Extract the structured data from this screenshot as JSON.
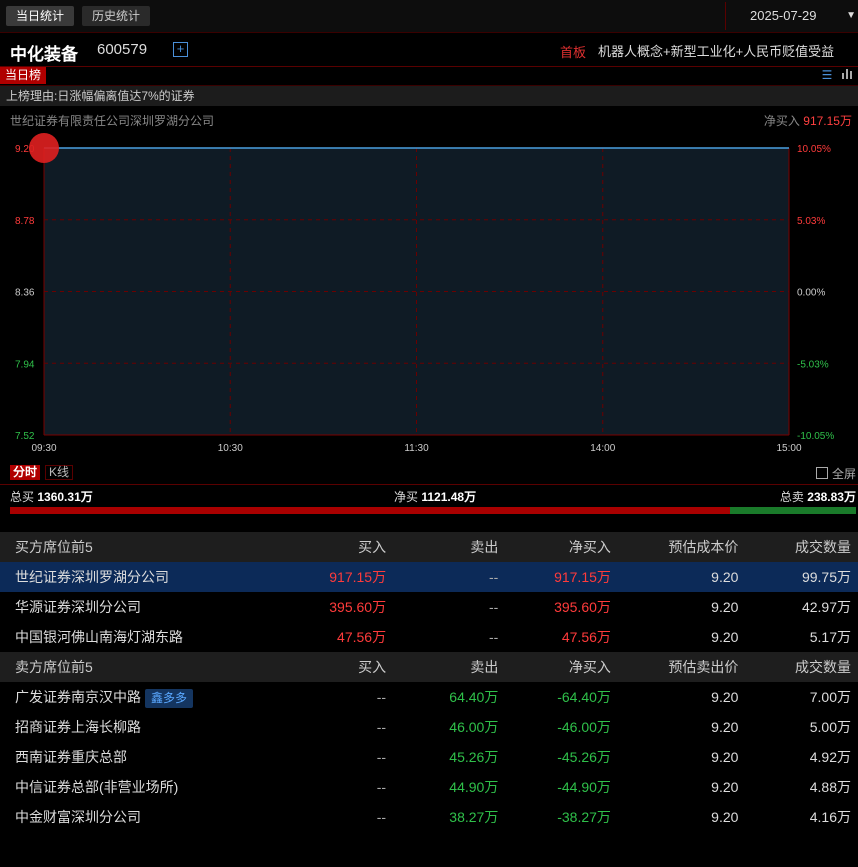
{
  "top": {
    "tabs": [
      {
        "label": "当日统计",
        "active": true
      },
      {
        "label": "历史统计",
        "active": false
      }
    ],
    "date": "2025-07-29"
  },
  "stock": {
    "name": "中化装备",
    "code": "600579",
    "board": "首板",
    "concepts": "机器人概念+新型工业化+人民币贬值受益"
  },
  "panel": {
    "tag": "当日榜",
    "reason": "上榜理由:日涨幅偏离值达7%的证券",
    "seat": "世纪证券有限责任公司深圳罗湖分公司",
    "netbuy_label": "净买入",
    "netbuy_value": "917.15万"
  },
  "chart_data": {
    "type": "line",
    "y_left_ticks": [
      "9.20",
      "8.78",
      "8.36",
      "7.94",
      "7.52"
    ],
    "y_right_ticks": [
      "10.05%",
      "5.03%",
      "0.00%",
      "-5.03%",
      "-10.05%"
    ],
    "x_ticks": [
      "09:30",
      "10:30",
      "11:30",
      "14:00",
      "15:00"
    ],
    "ylim": [
      7.52,
      9.2
    ],
    "x": [
      "09:30",
      "15:00"
    ],
    "y": [
      9.2,
      9.2
    ],
    "marker": {
      "time": "09:30",
      "price": 9.2
    }
  },
  "chart_tabs": {
    "active": "分时",
    "other": "K线",
    "fullscreen": "全屏"
  },
  "totals": {
    "buy_label": "总买",
    "buy_value": "1360.31万",
    "net_label": "净买",
    "net_value": "1121.48万",
    "sell_label": "总卖",
    "sell_value": "238.83万",
    "buy_ratio": 0.8507
  },
  "buy_table": {
    "headers": [
      "买方席位前5",
      "买入",
      "卖出",
      "净买入",
      "预估成本价",
      "成交数量"
    ],
    "rows": [
      {
        "name": "世纪证券深圳罗湖分公司",
        "buy": "917.15万",
        "sell": "--",
        "net": "917.15万",
        "price": "9.20",
        "qty": "99.75万"
      },
      {
        "name": "华源证券深圳分公司",
        "buy": "395.60万",
        "sell": "--",
        "net": "395.60万",
        "price": "9.20",
        "qty": "42.97万"
      },
      {
        "name": "中国银河佛山南海灯湖东路",
        "buy": "47.56万",
        "sell": "--",
        "net": "47.56万",
        "price": "9.20",
        "qty": "5.17万"
      }
    ]
  },
  "sell_table": {
    "headers": [
      "卖方席位前5",
      "买入",
      "卖出",
      "净买入",
      "预估卖出价",
      "成交数量"
    ],
    "rows": [
      {
        "name": "广发证券南京汉中路",
        "badge": "鑫多多",
        "buy": "--",
        "sell": "64.40万",
        "net": "-64.40万",
        "price": "9.20",
        "qty": "7.00万"
      },
      {
        "name": "招商证券上海长柳路",
        "badge": "",
        "buy": "--",
        "sell": "46.00万",
        "net": "-46.00万",
        "price": "9.20",
        "qty": "5.00万"
      },
      {
        "name": "西南证券重庆总部",
        "badge": "",
        "buy": "--",
        "sell": "45.26万",
        "net": "-45.26万",
        "price": "9.20",
        "qty": "4.92万"
      },
      {
        "name": "中信证券总部(非营业场所)",
        "badge": "",
        "buy": "--",
        "sell": "44.90万",
        "net": "-44.90万",
        "price": "9.20",
        "qty": "4.88万"
      },
      {
        "name": "中金财富深圳分公司",
        "badge": "",
        "buy": "--",
        "sell": "38.27万",
        "net": "-38.27万",
        "price": "9.20",
        "qty": "4.16万"
      }
    ]
  }
}
